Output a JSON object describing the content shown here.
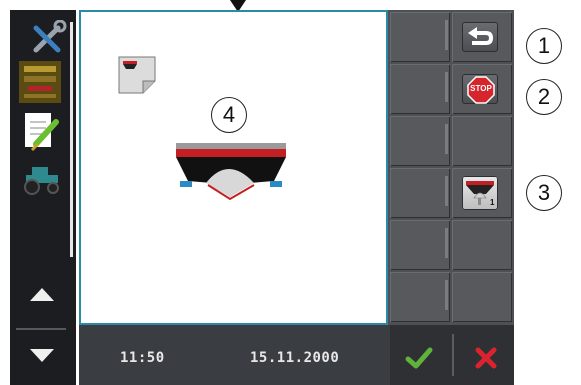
{
  "status_bar": {
    "time": "11:50",
    "date": "15.11.2000"
  },
  "callouts": [
    "1",
    "2",
    "3",
    "4"
  ],
  "softkeys": {
    "back_icon": "back-arrow-icon",
    "stop_label": "STOP",
    "section_number": "1"
  },
  "confirm": {
    "ok_icon": "checkmark-icon",
    "cancel_icon": "cross-icon"
  },
  "left_menu": {
    "items": [
      "tools-icon",
      "spreader-settings-icon",
      "checklist-icon",
      "tractor-icon"
    ]
  },
  "colors": {
    "accent": "#2a8aa8",
    "ok_green": "#5fb33a",
    "cancel_red": "#d9232e",
    "stop_red": "#d6262d"
  }
}
